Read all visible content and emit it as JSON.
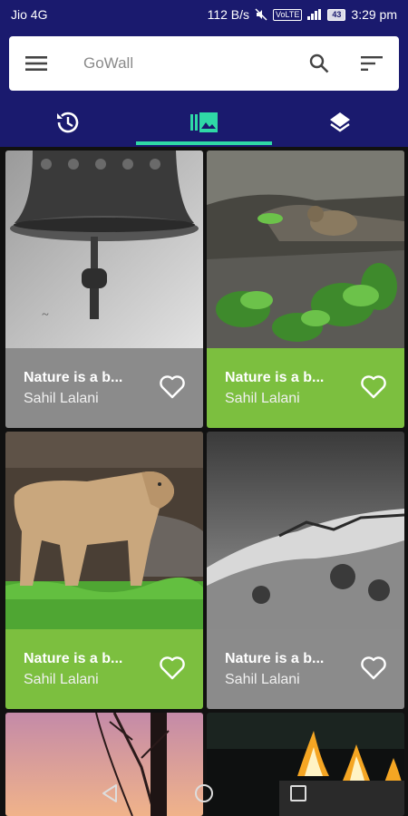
{
  "status_bar": {
    "carrier": "Jio 4G",
    "speed": "112 B/s",
    "volte": "VoLTE",
    "battery": "43",
    "time": "3:29 pm"
  },
  "search_bar": {
    "title": "GoWall",
    "menu_icon": "menu-icon",
    "search_icon": "search-icon",
    "sort_icon": "sort-icon"
  },
  "tabs": [
    {
      "icon": "history-icon",
      "active": false
    },
    {
      "icon": "gallery-icon",
      "active": true
    },
    {
      "icon": "layers-icon",
      "active": false
    }
  ],
  "wallpapers": [
    {
      "title": "Nature is a b...",
      "author": "Sahil Lalani",
      "footer_color": "#8b8b8b",
      "subject": "bell"
    },
    {
      "title": "Nature is a b...",
      "author": "Sahil Lalani",
      "footer_color": "#7cbf3f",
      "subject": "squirrel"
    },
    {
      "title": "Nature is a b...",
      "author": "Sahil Lalani",
      "footer_color": "#7cbf3f",
      "subject": "lioness"
    },
    {
      "title": "Nature is a b...",
      "author": "Sahil Lalani",
      "footer_color": "#8b8b8b",
      "subject": "snow-mountain"
    }
  ],
  "colors": {
    "primary": "#1a1a6e",
    "tab_indicator": "#2fd9a6",
    "card_gray": "#8b8b8b",
    "card_green": "#7cbf3f"
  },
  "nav_bar": {
    "back_icon": "back-icon",
    "home_icon": "home-icon",
    "recents_icon": "recents-icon"
  }
}
